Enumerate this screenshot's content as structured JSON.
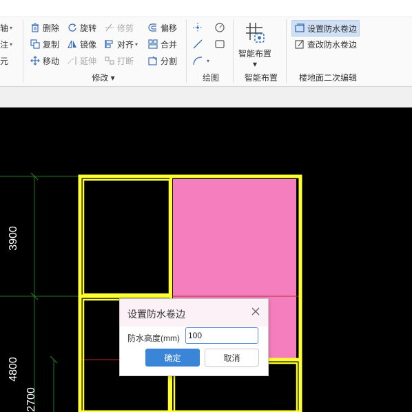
{
  "ribbon": {
    "left_partial": [
      "轴",
      "注",
      "元"
    ],
    "modify": {
      "items": [
        {
          "label": "删除",
          "icon": "trash-icon",
          "enabled": true
        },
        {
          "label": "旋转",
          "icon": "rotate-icon",
          "enabled": true
        },
        {
          "label": "修剪",
          "icon": "trim-icon",
          "enabled": false
        },
        {
          "label": "偏移",
          "icon": "offset-icon",
          "enabled": true
        },
        {
          "label": "复制",
          "icon": "copy-icon",
          "enabled": true
        },
        {
          "label": "镜像",
          "icon": "mirror-icon",
          "enabled": true
        },
        {
          "label": "对齐",
          "icon": "align-icon",
          "enabled": true
        },
        {
          "label": "合并",
          "icon": "merge-icon",
          "enabled": true
        },
        {
          "label": "移动",
          "icon": "move-icon",
          "enabled": true
        },
        {
          "label": "延伸",
          "icon": "extend-icon",
          "enabled": false
        },
        {
          "label": "打断",
          "icon": "break-icon",
          "enabled": false
        },
        {
          "label": "分割",
          "icon": "split-icon",
          "enabled": true
        }
      ],
      "group_label": "修改"
    },
    "draw": {
      "group_label": "绘图"
    },
    "smart_layout": {
      "button_label": "智能布置",
      "group_label": "智能布置"
    },
    "floor_edit": {
      "items": [
        {
          "label": "设置防水卷边",
          "icon": "set-waterproof-edge-icon",
          "selected": true
        },
        {
          "label": "查改防水卷边",
          "icon": "edit-waterproof-edge-icon",
          "selected": false
        }
      ],
      "group_label": "楼地面二次编辑"
    }
  },
  "canvas": {
    "dimensions": [
      "3900",
      "4800",
      "2700"
    ],
    "colors": {
      "background": "#000000",
      "wall": "#ffff33",
      "fill": "#f57fbe",
      "dim_line": "#1f7a1f",
      "axis": "#c0282a"
    }
  },
  "dialog": {
    "title": "设置防水卷边",
    "field_label": "防水高度(mm)",
    "field_value": "100",
    "ok_label": "确定",
    "cancel_label": "取消"
  }
}
